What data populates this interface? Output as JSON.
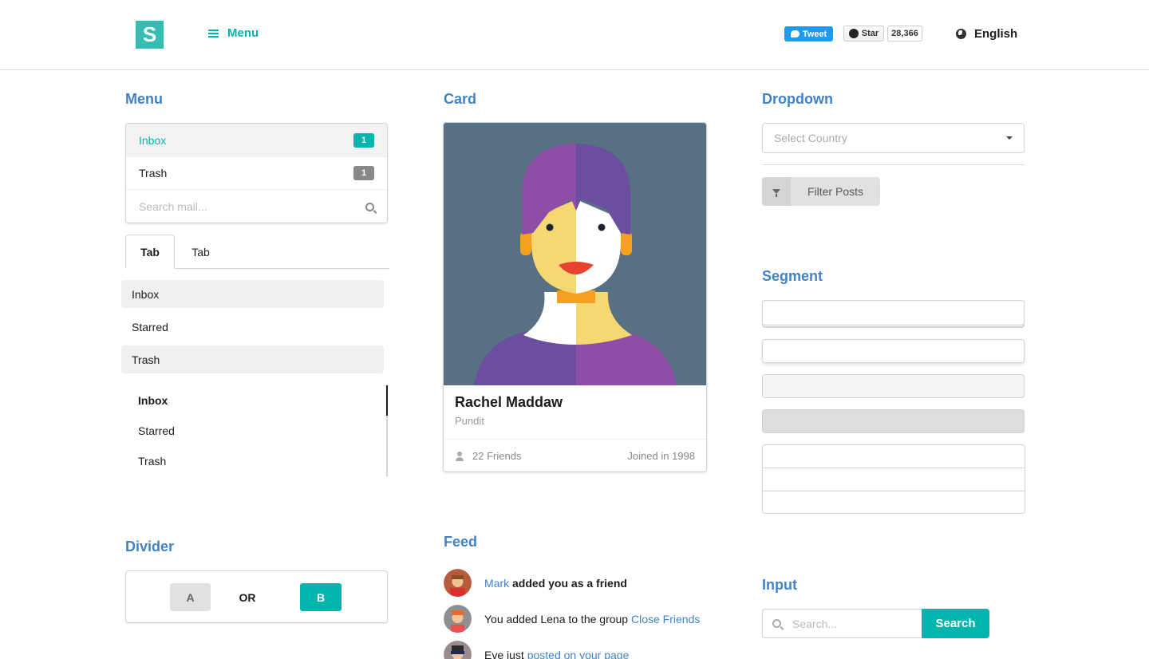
{
  "header": {
    "logo_letter": "S",
    "menu_label": "Menu",
    "tweet_label": "Tweet",
    "star_label": "Star",
    "star_count": "28,366",
    "language": "English"
  },
  "sections": {
    "menu": "Menu",
    "card": "Card",
    "dropdown": "Dropdown",
    "segment": "Segment",
    "divider": "Divider",
    "feed": "Feed",
    "input": "Input"
  },
  "vmenu": {
    "items": [
      {
        "label": "Inbox",
        "count": "1"
      },
      {
        "label": "Trash",
        "count": "1"
      }
    ],
    "search_placeholder": "Search mail..."
  },
  "tabs": [
    "Tab",
    "Tab"
  ],
  "pointing_menu": [
    "Inbox",
    "Starred",
    "Trash"
  ],
  "secondary_menu": [
    "Inbox",
    "Starred",
    "Trash"
  ],
  "divider": {
    "a": "A",
    "or": "OR",
    "b": "B"
  },
  "card": {
    "name": "Rachel Maddaw",
    "meta": "Pundit",
    "friends": "22 Friends",
    "joined": "Joined in 1998"
  },
  "feed": [
    {
      "pre": "",
      "link": "Mark",
      "post": " added you as a friend"
    },
    {
      "pre": "You added Lena to the group ",
      "link": "Close Friends",
      "post": ""
    },
    {
      "pre": "Eve just ",
      "link": "posted on your page",
      "post": ""
    }
  ],
  "dropdown": {
    "placeholder": "Select Country"
  },
  "filter_label": "Filter Posts",
  "input": {
    "placeholder": "Search...",
    "button": "Search"
  },
  "colors": {
    "teal": "#00b5ad",
    "blue": "#4183c4",
    "card_bg": "#587083"
  }
}
